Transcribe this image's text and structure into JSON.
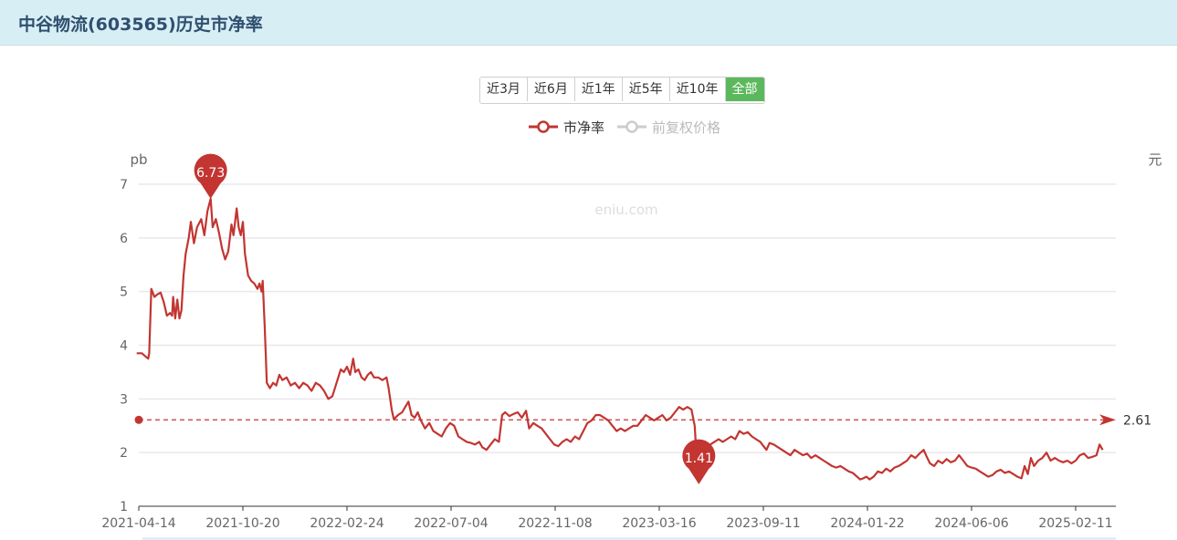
{
  "header": {
    "title": "中谷物流(603565)历史市净率"
  },
  "range_buttons": [
    {
      "label": "近3月",
      "active": false
    },
    {
      "label": "近6月",
      "active": false
    },
    {
      "label": "近1年",
      "active": false
    },
    {
      "label": "近5年",
      "active": false
    },
    {
      "label": "近10年",
      "active": false
    },
    {
      "label": "全部",
      "active": true
    }
  ],
  "legend": [
    {
      "name": "市净率",
      "color": "#c23531",
      "active": true
    },
    {
      "name": "前复权价格",
      "color": "#cccccc",
      "active": false
    }
  ],
  "watermark": "eniu.com",
  "chart_data": {
    "type": "line",
    "left_axis_unit": "pb",
    "right_axis_unit": "元",
    "ylim": [
      1,
      7
    ],
    "y_ticks": [
      "1",
      "2",
      "3",
      "4",
      "5",
      "6",
      "7"
    ],
    "x_ticks": [
      "2021-04-14",
      "2021-10-20",
      "2022-02-24",
      "2022-07-04",
      "2022-11-08",
      "2023-03-16",
      "2023-09-11",
      "2024-01-22",
      "2024-06-06",
      "2025-02-11"
    ],
    "grid": true,
    "legend_position": "top-center",
    "average": {
      "value": 2.61,
      "label": "2.61"
    },
    "max_marker": {
      "x": 6.9,
      "value": 6.73,
      "label": "6.73"
    },
    "min_marker": {
      "x": 53.8,
      "value": 1.41,
      "label": "1.41"
    },
    "series": [
      {
        "name": "市净率",
        "color": "#c23531",
        "points": [
          [
            -0.2,
            3.85
          ],
          [
            0.3,
            3.85
          ],
          [
            0.6,
            3.8
          ],
          [
            0.9,
            3.75
          ],
          [
            1.0,
            3.85
          ],
          [
            1.2,
            5.05
          ],
          [
            1.5,
            4.9
          ],
          [
            1.8,
            4.95
          ],
          [
            2.1,
            4.98
          ],
          [
            2.4,
            4.8
          ],
          [
            2.7,
            4.55
          ],
          [
            3.0,
            4.6
          ],
          [
            3.2,
            4.55
          ],
          [
            3.3,
            4.9
          ],
          [
            3.5,
            4.5
          ],
          [
            3.7,
            4.85
          ],
          [
            3.9,
            4.5
          ],
          [
            4.1,
            4.65
          ],
          [
            4.3,
            5.3
          ],
          [
            4.5,
            5.7
          ],
          [
            4.8,
            6.0
          ],
          [
            5.0,
            6.3
          ],
          [
            5.3,
            5.9
          ],
          [
            5.6,
            6.2
          ],
          [
            6.0,
            6.35
          ],
          [
            6.3,
            6.05
          ],
          [
            6.6,
            6.5
          ],
          [
            6.9,
            6.73
          ],
          [
            7.1,
            6.2
          ],
          [
            7.4,
            6.35
          ],
          [
            7.7,
            6.1
          ],
          [
            8.0,
            5.8
          ],
          [
            8.3,
            5.6
          ],
          [
            8.6,
            5.75
          ],
          [
            8.9,
            6.25
          ],
          [
            9.1,
            6.05
          ],
          [
            9.4,
            6.55
          ],
          [
            9.6,
            6.2
          ],
          [
            9.8,
            6.05
          ],
          [
            10.0,
            6.3
          ],
          [
            10.2,
            5.7
          ],
          [
            10.5,
            5.3
          ],
          [
            10.8,
            5.2
          ],
          [
            11.1,
            5.15
          ],
          [
            11.4,
            5.05
          ],
          [
            11.6,
            5.15
          ],
          [
            11.8,
            5.0
          ],
          [
            11.9,
            5.2
          ],
          [
            12.1,
            4.35
          ],
          [
            12.3,
            3.3
          ],
          [
            12.6,
            3.2
          ],
          [
            12.9,
            3.3
          ],
          [
            13.2,
            3.25
          ],
          [
            13.5,
            3.45
          ],
          [
            13.8,
            3.35
          ],
          [
            14.2,
            3.4
          ],
          [
            14.6,
            3.25
          ],
          [
            15.0,
            3.3
          ],
          [
            15.4,
            3.2
          ],
          [
            15.8,
            3.3
          ],
          [
            16.2,
            3.25
          ],
          [
            16.6,
            3.15
          ],
          [
            17.0,
            3.3
          ],
          [
            17.4,
            3.25
          ],
          [
            17.8,
            3.15
          ],
          [
            18.2,
            3.0
          ],
          [
            18.6,
            3.05
          ],
          [
            19.0,
            3.3
          ],
          [
            19.4,
            3.55
          ],
          [
            19.7,
            3.5
          ],
          [
            20.0,
            3.6
          ],
          [
            20.3,
            3.45
          ],
          [
            20.6,
            3.75
          ],
          [
            20.8,
            3.5
          ],
          [
            21.1,
            3.55
          ],
          [
            21.4,
            3.4
          ],
          [
            21.7,
            3.35
          ],
          [
            22.0,
            3.45
          ],
          [
            22.3,
            3.5
          ],
          [
            22.6,
            3.4
          ],
          [
            23.0,
            3.4
          ],
          [
            23.4,
            3.35
          ],
          [
            23.8,
            3.4
          ],
          [
            24.0,
            3.2
          ],
          [
            24.3,
            2.8
          ],
          [
            24.5,
            2.62
          ],
          [
            24.9,
            2.7
          ],
          [
            25.3,
            2.75
          ],
          [
            25.6,
            2.85
          ],
          [
            25.9,
            2.95
          ],
          [
            26.2,
            2.7
          ],
          [
            26.5,
            2.65
          ],
          [
            26.8,
            2.75
          ],
          [
            27.1,
            2.6
          ],
          [
            27.5,
            2.45
          ],
          [
            27.9,
            2.55
          ],
          [
            28.3,
            2.4
          ],
          [
            28.7,
            2.35
          ],
          [
            29.1,
            2.3
          ],
          [
            29.5,
            2.45
          ],
          [
            29.9,
            2.55
          ],
          [
            30.3,
            2.5
          ],
          [
            30.7,
            2.3
          ],
          [
            31.1,
            2.25
          ],
          [
            31.5,
            2.2
          ],
          [
            31.9,
            2.18
          ],
          [
            32.3,
            2.15
          ],
          [
            32.7,
            2.2
          ],
          [
            33.0,
            2.1
          ],
          [
            33.4,
            2.05
          ],
          [
            33.8,
            2.15
          ],
          [
            34.2,
            2.25
          ],
          [
            34.6,
            2.2
          ],
          [
            34.9,
            2.7
          ],
          [
            35.2,
            2.75
          ],
          [
            35.6,
            2.68
          ],
          [
            36.0,
            2.72
          ],
          [
            36.4,
            2.75
          ],
          [
            36.8,
            2.65
          ],
          [
            37.2,
            2.78
          ],
          [
            37.5,
            2.45
          ],
          [
            37.9,
            2.55
          ],
          [
            38.3,
            2.5
          ],
          [
            38.7,
            2.45
          ],
          [
            39.1,
            2.35
          ],
          [
            39.5,
            2.25
          ],
          [
            39.9,
            2.15
          ],
          [
            40.3,
            2.12
          ],
          [
            40.7,
            2.2
          ],
          [
            41.1,
            2.25
          ],
          [
            41.5,
            2.2
          ],
          [
            41.9,
            2.3
          ],
          [
            42.3,
            2.25
          ],
          [
            42.7,
            2.4
          ],
          [
            43.1,
            2.55
          ],
          [
            43.5,
            2.6
          ],
          [
            43.9,
            2.7
          ],
          [
            44.3,
            2.7
          ],
          [
            44.7,
            2.65
          ],
          [
            45.1,
            2.6
          ],
          [
            45.5,
            2.5
          ],
          [
            45.9,
            2.4
          ],
          [
            46.3,
            2.45
          ],
          [
            46.7,
            2.4
          ],
          [
            47.1,
            2.45
          ],
          [
            47.5,
            2.5
          ],
          [
            47.9,
            2.5
          ],
          [
            48.3,
            2.6
          ],
          [
            48.7,
            2.7
          ],
          [
            49.1,
            2.65
          ],
          [
            49.5,
            2.6
          ],
          [
            49.9,
            2.65
          ],
          [
            50.3,
            2.7
          ],
          [
            50.7,
            2.6
          ],
          [
            51.1,
            2.65
          ],
          [
            51.5,
            2.75
          ],
          [
            51.9,
            2.85
          ],
          [
            52.3,
            2.8
          ],
          [
            52.7,
            2.85
          ],
          [
            53.1,
            2.8
          ],
          [
            53.4,
            2.5
          ],
          [
            53.6,
            1.9
          ],
          [
            53.8,
            1.45
          ],
          [
            54.1,
            1.9
          ],
          [
            54.5,
            2.05
          ],
          [
            54.9,
            2.15
          ],
          [
            55.3,
            2.2
          ],
          [
            55.7,
            2.25
          ],
          [
            56.1,
            2.2
          ],
          [
            56.5,
            2.25
          ],
          [
            56.9,
            2.3
          ],
          [
            57.3,
            2.25
          ],
          [
            57.7,
            2.4
          ],
          [
            58.1,
            2.35
          ],
          [
            58.5,
            2.38
          ],
          [
            58.9,
            2.3
          ],
          [
            59.3,
            2.25
          ],
          [
            59.7,
            2.2
          ],
          [
            60.1,
            2.1
          ],
          [
            60.3,
            2.05
          ],
          [
            60.6,
            2.18
          ],
          [
            61.0,
            2.15
          ],
          [
            61.4,
            2.1
          ],
          [
            61.8,
            2.05
          ],
          [
            62.2,
            2.0
          ],
          [
            62.6,
            1.95
          ],
          [
            63.0,
            2.05
          ],
          [
            63.4,
            2.0
          ],
          [
            63.8,
            1.95
          ],
          [
            64.2,
            1.98
          ],
          [
            64.6,
            1.9
          ],
          [
            65.0,
            1.95
          ],
          [
            65.4,
            1.9
          ],
          [
            65.8,
            1.85
          ],
          [
            66.2,
            1.8
          ],
          [
            66.6,
            1.75
          ],
          [
            67.0,
            1.72
          ],
          [
            67.4,
            1.75
          ],
          [
            67.8,
            1.7
          ],
          [
            68.2,
            1.65
          ],
          [
            68.6,
            1.62
          ],
          [
            69.0,
            1.55
          ],
          [
            69.3,
            1.5
          ],
          [
            69.6,
            1.52
          ],
          [
            69.9,
            1.55
          ],
          [
            70.2,
            1.5
          ],
          [
            70.6,
            1.55
          ],
          [
            71.0,
            1.65
          ],
          [
            71.4,
            1.62
          ],
          [
            71.8,
            1.7
          ],
          [
            72.2,
            1.65
          ],
          [
            72.6,
            1.72
          ],
          [
            73.0,
            1.75
          ],
          [
            73.4,
            1.8
          ],
          [
            73.8,
            1.85
          ],
          [
            74.2,
            1.95
          ],
          [
            74.6,
            1.9
          ],
          [
            75.0,
            1.98
          ],
          [
            75.4,
            2.05
          ],
          [
            75.7,
            1.92
          ],
          [
            76.0,
            1.8
          ],
          [
            76.4,
            1.75
          ],
          [
            76.8,
            1.85
          ],
          [
            77.2,
            1.8
          ],
          [
            77.6,
            1.88
          ],
          [
            78.0,
            1.82
          ],
          [
            78.4,
            1.85
          ],
          [
            78.8,
            1.95
          ],
          [
            79.2,
            1.85
          ],
          [
            79.6,
            1.75
          ],
          [
            80.0,
            1.72
          ],
          [
            80.4,
            1.7
          ],
          [
            80.8,
            1.65
          ],
          [
            81.2,
            1.6
          ],
          [
            81.6,
            1.55
          ],
          [
            82.0,
            1.58
          ],
          [
            82.4,
            1.65
          ],
          [
            82.8,
            1.68
          ],
          [
            83.2,
            1.62
          ],
          [
            83.6,
            1.65
          ],
          [
            84.0,
            1.6
          ],
          [
            84.4,
            1.55
          ],
          [
            84.8,
            1.52
          ],
          [
            85.1,
            1.75
          ],
          [
            85.4,
            1.6
          ],
          [
            85.7,
            1.9
          ],
          [
            86.0,
            1.75
          ],
          [
            86.4,
            1.85
          ],
          [
            86.8,
            1.9
          ],
          [
            87.2,
            2.0
          ],
          [
            87.6,
            1.85
          ],
          [
            88.0,
            1.9
          ],
          [
            88.4,
            1.85
          ],
          [
            88.8,
            1.82
          ],
          [
            89.2,
            1.85
          ],
          [
            89.6,
            1.8
          ],
          [
            90.0,
            1.85
          ],
          [
            90.4,
            1.95
          ],
          [
            90.8,
            1.98
          ],
          [
            91.2,
            1.9
          ],
          [
            91.6,
            1.92
          ],
          [
            92.0,
            1.95
          ],
          [
            92.3,
            2.15
          ],
          [
            92.6,
            2.05
          ]
        ]
      }
    ]
  }
}
